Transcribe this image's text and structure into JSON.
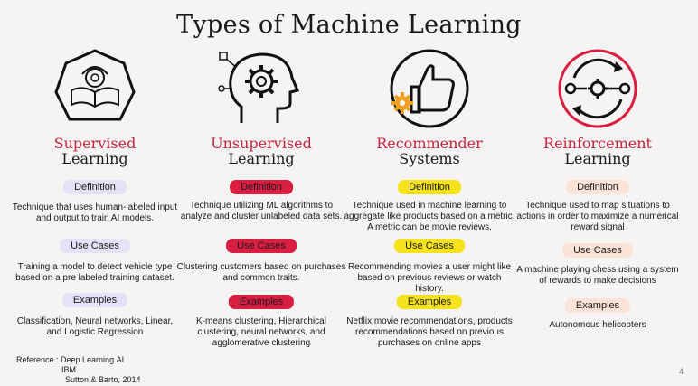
{
  "title": "Types of Machine Learning",
  "columns": [
    {
      "icon": "book-brain-icon",
      "head_line1": "Supervised",
      "head_line2": "Learning",
      "definition_label": "Definition",
      "definition": "Technique that uses human-labeled input and output to train AI models.",
      "use_cases_label": "Use Cases",
      "use_cases": "Training a model to detect vehicle type based on a pre labeled training dataset.",
      "examples_label": "Examples",
      "examples": "Classification, Neural networks, Linear, and Logistic Regression",
      "pill_color": "#e3e2f7",
      "pill_text_color": "#1a1a1a"
    },
    {
      "icon": "head-gear-icon",
      "head_line1": "Unsupervised",
      "head_line2": "Learning",
      "definition_label": "Definition",
      "definition": "Technique utilizing ML algorithms to analyze and cluster unlabeled data sets.",
      "use_cases_label": "Use Cases",
      "use_cases": "Clustering customers based on purchases and common traits.",
      "examples_label": "Examples",
      "examples": "K-means clustering, Hierarchical clustering, neural networks, and agglomerative clustering",
      "pill_color": "#d81e41",
      "pill_text_color": "#1a1a1a"
    },
    {
      "icon": "thumbs-up-gear-icon",
      "head_line1": "Recommender",
      "head_line2": "Systems",
      "definition_label": "Definition",
      "definition": "Technique used in machine learning to aggregate like products based on a metric. A metric can be movie reviews.",
      "use_cases_label": "Use Cases",
      "use_cases": "Recommending movies a user might like based on previous reviews or watch history.",
      "examples_label": "Examples",
      "examples": "Netflix movie recommendations, products recommendations based on previous purchases on online apps",
      "pill_color": "#f5e21d",
      "pill_text_color": "#1a1a1a"
    },
    {
      "icon": "reinforcement-cycle-icon",
      "head_line1": "Reinforcement",
      "head_line2": "Learning",
      "definition_label": "Definition",
      "definition": "Technique used to map situations to actions in order to maximize a numerical reward signal",
      "use_cases_label": "Use Cases",
      "use_cases": "A machine playing chess using a system of rewards to make decisions",
      "examples_label": "Examples",
      "examples": "Autonomous helicopters",
      "pill_color": "#fbe3d8",
      "pill_text_color": "#1a1a1a"
    }
  ],
  "reference": {
    "line1": "Reference : Deep Learning.AI",
    "line2": "IBM",
    "line3": "Sutton & Barto, 2014"
  },
  "page_number": "4"
}
